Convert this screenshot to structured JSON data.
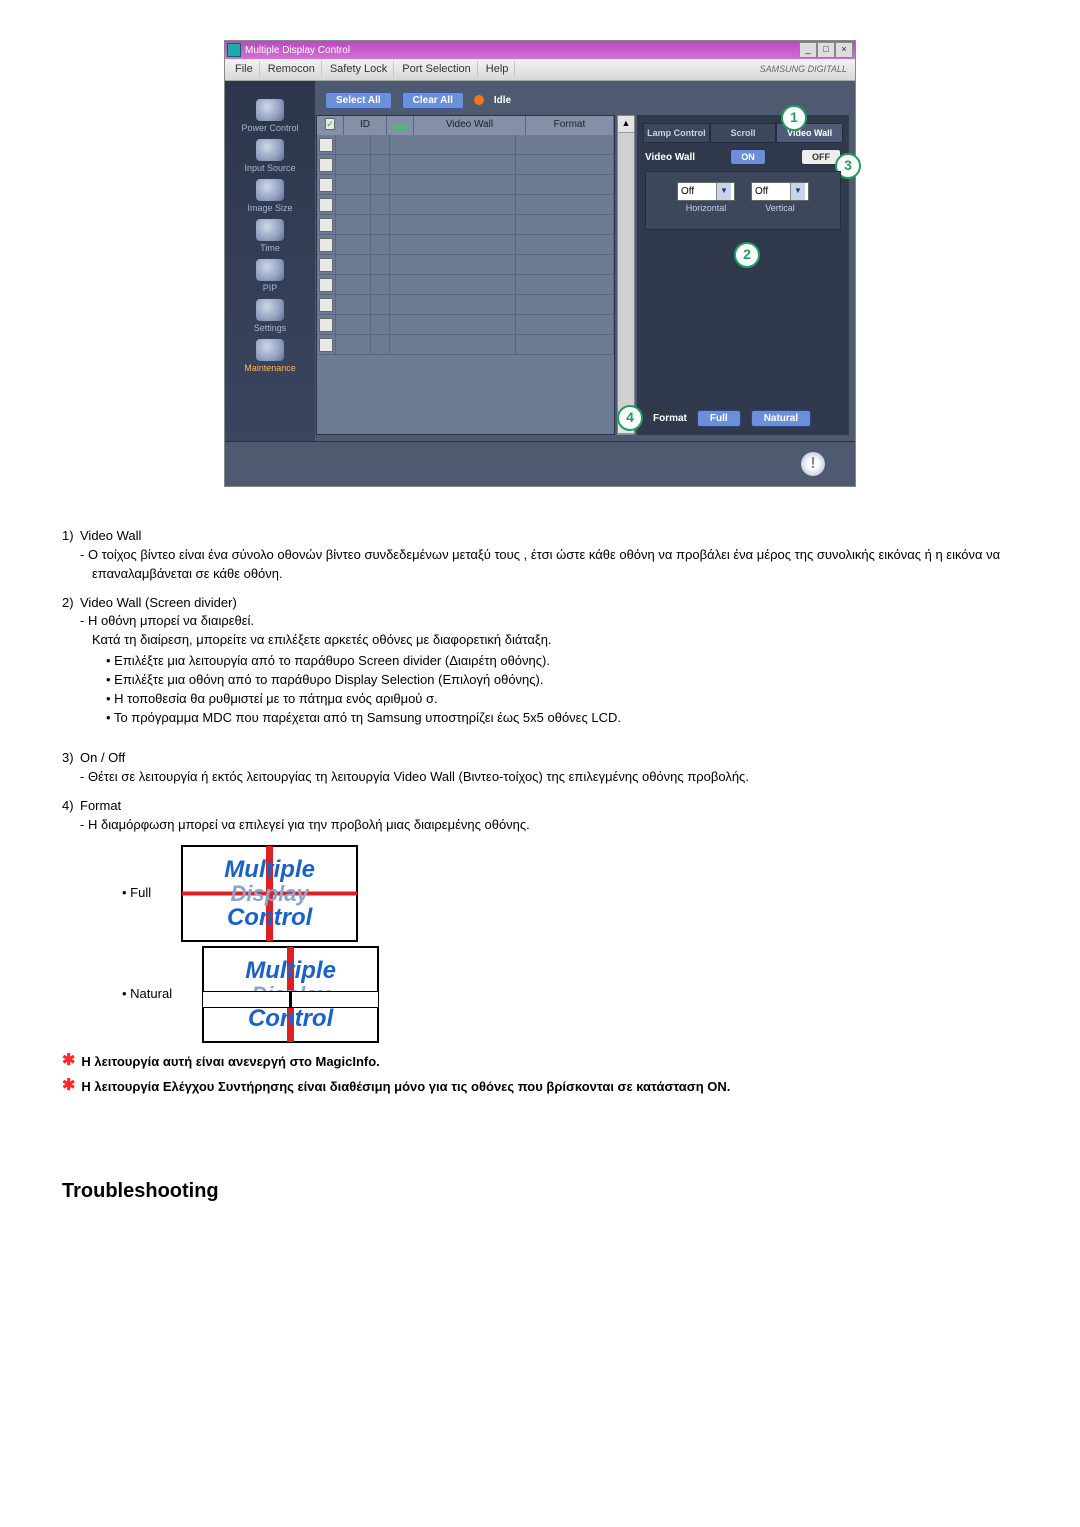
{
  "app": {
    "title": "Multiple Display Control",
    "brand": "SAMSUNG DIGITALL",
    "window_buttons": {
      "min": "_",
      "max": "□",
      "close": "×"
    },
    "menu": [
      "File",
      "Remocon",
      "Safety Lock",
      "Port Selection",
      "Help"
    ],
    "sidebar": [
      {
        "label": "Power Control"
      },
      {
        "label": "Input Source"
      },
      {
        "label": "Image Size"
      },
      {
        "label": "Time"
      },
      {
        "label": "PIP"
      },
      {
        "label": "Settings"
      },
      {
        "label": "Maintenance",
        "highlight": true
      }
    ],
    "toolbar": {
      "select_all": "Select All",
      "clear_all": "Clear All",
      "idle": "Idle"
    },
    "grid": {
      "headers": {
        "checkbox": "✓",
        "id": "ID",
        "signal": " ",
        "video_wall": "Video Wall",
        "format": "Format"
      },
      "rows": 11
    },
    "right": {
      "tabs": [
        "Lamp Control",
        "Scroll",
        "Video Wall"
      ],
      "active_tab": 2,
      "video_wall_label": "Video Wall",
      "on": "ON",
      "off": "OFF",
      "horizontal_label": "Horizontal",
      "vertical_label": "Vertical",
      "horizontal_value": "Off",
      "vertical_value": "Off",
      "format_label": "Format",
      "format_full": "Full",
      "format_natural": "Natural"
    },
    "annotations": {
      "1": "1",
      "2": "2",
      "3": "3",
      "4": "4"
    },
    "status_icon": "!"
  },
  "doc": {
    "item1_title": "Video Wall",
    "item1_body": "Ο τοίχος βίντεο είναι ένα σύνολο οθονών βίντεο συνδεδεμένων μεταξύ τους , έτσι ώστε κάθε οθόνη να προβάλει ένα μέρος της συνολικής εικόνας ή η εικόνα να επαναλαμβάνεται σε κάθε οθόνη.",
    "item2_title": "Video Wall (Screen divider)",
    "item2_line1": "Η οθόνη μπορεί να διαιρεθεί.",
    "item2_line2": "Κατά τη διαίρεση, μπορείτε να επιλέξετε αρκετές οθόνες με διαφορετική διάταξη.",
    "item2_bul": [
      "Επιλέξτε μια λειτουργία από το παράθυρο Screen divider (Διαιρέτη οθόνης).",
      "Επιλέξτε μια οθόνη από το παράθυρο Display Selection (Επιλογή οθόνης).",
      "Η τοποθεσία θα ρυθμιστεί με το πάτημα ενός αριθμού σ.",
      "Το πρόγραμμα MDC που παρέχεται από τη Samsung υποστηρίζει έως 5x5 οθόνες LCD."
    ],
    "item3_title": "On / Off",
    "item3_body": "Θέτει σε λειτουργία ή εκτός λειτουργίας τη λειτουργία Video Wall (Βιντεο-τοίχος) της επιλεγμένης οθόνης προβολής.",
    "item4_title": "Format",
    "item4_body": "Η διαμόρφωση μπορεί να επιλεγεί για την προβολή μιας διαιρεμένης οθόνης.",
    "split": {
      "full": "Full",
      "natural": "Natural",
      "word1": "Multiple",
      "word2": "Display",
      "word3": "Control"
    },
    "note1": "Η λειτουργία αυτή είναι ανενεργή στο MagicInfo.",
    "note2": "Η λειτουργία Ελέγχου Συντήρησης είναι διαθέσιμη μόνο για τις οθόνες που βρίσκονται σε κατάσταση ON.",
    "troubleshooting": "Troubleshooting"
  }
}
